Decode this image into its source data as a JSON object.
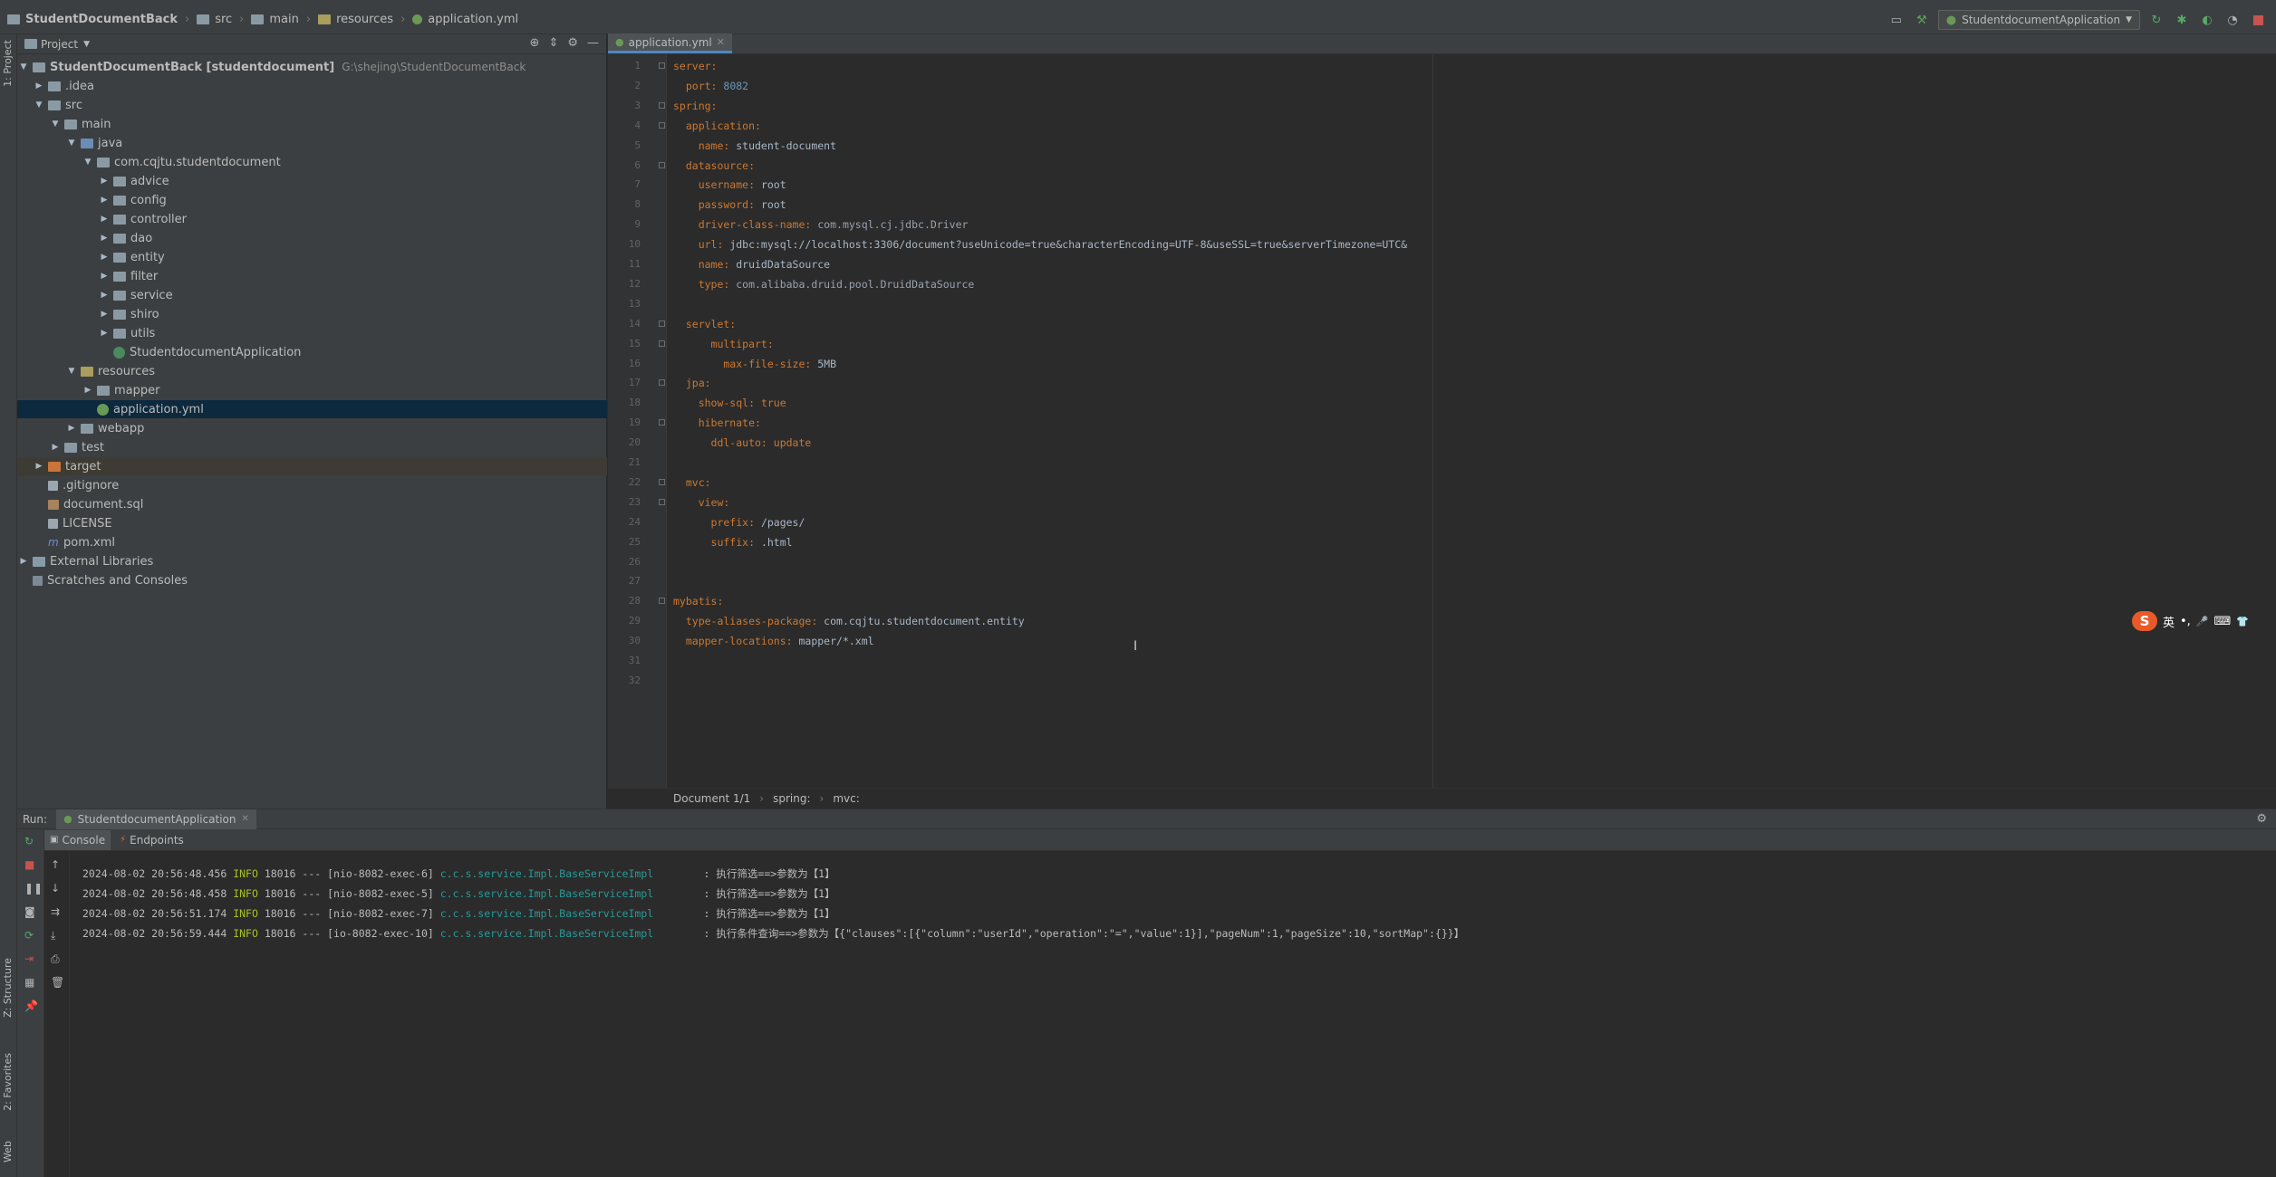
{
  "navbar": {
    "crumbs": [
      "StudentDocumentBack",
      "src",
      "main",
      "resources",
      "application.yml"
    ],
    "run_config": "StudentdocumentApplication"
  },
  "side_tabs": {
    "project": "1: Project",
    "structure": "Z: Structure",
    "favorites": "2: Favorites",
    "web": "Web"
  },
  "project_panel": {
    "title": "Project",
    "tree": [
      {
        "label": "StudentDocumentBack [studentdocument]",
        "path": "G:\\shejing\\StudentDocumentBack"
      },
      {
        "label": ".idea"
      },
      {
        "label": "src"
      },
      {
        "label": "main"
      },
      {
        "label": "java"
      },
      {
        "label": "com.cqjtu.studentdocument"
      },
      {
        "label": "advice"
      },
      {
        "label": "config"
      },
      {
        "label": "controller"
      },
      {
        "label": "dao"
      },
      {
        "label": "entity"
      },
      {
        "label": "filter"
      },
      {
        "label": "service"
      },
      {
        "label": "shiro"
      },
      {
        "label": "utils"
      },
      {
        "label": "StudentdocumentApplication"
      },
      {
        "label": "resources"
      },
      {
        "label": "mapper"
      },
      {
        "label": "application.yml"
      },
      {
        "label": "webapp"
      },
      {
        "label": "test"
      },
      {
        "label": "target"
      },
      {
        "label": ".gitignore"
      },
      {
        "label": "document.sql"
      },
      {
        "label": "LICENSE"
      },
      {
        "label": "pom.xml"
      },
      {
        "label": "External Libraries"
      },
      {
        "label": "Scratches and Consoles"
      }
    ]
  },
  "editor": {
    "tab": "application.yml",
    "lines": [
      {
        "n": "1",
        "key": "server:",
        "val": ""
      },
      {
        "n": "2",
        "key": "  port:",
        "val": " 8082"
      },
      {
        "n": "3",
        "key": "spring:",
        "val": ""
      },
      {
        "n": "4",
        "key": "  application:",
        "val": ""
      },
      {
        "n": "5",
        "key": "    name:",
        "val": " student-document"
      },
      {
        "n": "6",
        "key": "  datasource:",
        "val": ""
      },
      {
        "n": "7",
        "key": "    username:",
        "val": " root"
      },
      {
        "n": "8",
        "key": "    password:",
        "val": " root"
      },
      {
        "n": "9",
        "key": "    driver-class-name:",
        "val": " com.mysql.cj.jdbc.Driver"
      },
      {
        "n": "10",
        "key": "    url:",
        "val": " jdbc:mysql://localhost:3306/document?useUnicode=true&characterEncoding=UTF-8&useSSL=true&serverTimezone=UTC&"
      },
      {
        "n": "11",
        "key": "    name:",
        "val": " druidDataSource"
      },
      {
        "n": "12",
        "key": "    type:",
        "val": " com.alibaba.druid.pool.DruidDataSource"
      },
      {
        "n": "13",
        "key": "",
        "val": ""
      },
      {
        "n": "14",
        "key": "  servlet:",
        "val": ""
      },
      {
        "n": "15",
        "key": "      multipart:",
        "val": ""
      },
      {
        "n": "16",
        "key": "        max-file-size:",
        "val": " 5MB"
      },
      {
        "n": "17",
        "key": "  jpa:",
        "val": ""
      },
      {
        "n": "18",
        "key": "    show-sql:",
        "val": " true"
      },
      {
        "n": "19",
        "key": "    hibernate:",
        "val": ""
      },
      {
        "n": "20",
        "key": "      ddl-auto:",
        "val": " update"
      },
      {
        "n": "21",
        "key": "",
        "val": ""
      },
      {
        "n": "22",
        "key": "  mvc:",
        "val": ""
      },
      {
        "n": "23",
        "key": "    view:",
        "val": ""
      },
      {
        "n": "24",
        "key": "      prefix:",
        "val": " /pages/"
      },
      {
        "n": "25",
        "key": "      suffix:",
        "val": " .html"
      },
      {
        "n": "26",
        "key": "",
        "val": ""
      },
      {
        "n": "27",
        "key": "",
        "val": ""
      },
      {
        "n": "28",
        "key": "mybatis:",
        "val": ""
      },
      {
        "n": "29",
        "key": "  type-aliases-package:",
        "val": " com.cqjtu.studentdocument.entity"
      },
      {
        "n": "30",
        "key": "  mapper-locations:",
        "val": " mapper/*.xml"
      },
      {
        "n": "31",
        "key": "",
        "val": ""
      },
      {
        "n": "32",
        "key": "",
        "val": ""
      }
    ],
    "breadcrumb": [
      "Document 1/1",
      "spring:",
      "mvc:"
    ]
  },
  "ime": {
    "logo": "S",
    "lang": "英",
    "punct": "•,",
    "mic": "🎤",
    "kbd": "⌨",
    "skin": "👕"
  },
  "run_panel": {
    "label": "Run:",
    "app_tab": "StudentdocumentApplication",
    "tabs": [
      "Console",
      "Endpoints"
    ],
    "log": [
      {
        "ts": "2024-08-02 20:56:48.456",
        "level": "INFO",
        "pid": "18016",
        "sep": "---",
        "thread": "[nio-8082-exec-6]",
        "cls": "c.c.s.service.Impl.BaseServiceImpl",
        "msg": ": 执行筛选==>参数为【1】"
      },
      {
        "ts": "2024-08-02 20:56:48.458",
        "level": "INFO",
        "pid": "18016",
        "sep": "---",
        "thread": "[nio-8082-exec-5]",
        "cls": "c.c.s.service.Impl.BaseServiceImpl",
        "msg": ": 执行筛选==>参数为【1】"
      },
      {
        "ts": "2024-08-02 20:56:51.174",
        "level": "INFO",
        "pid": "18016",
        "sep": "---",
        "thread": "[nio-8082-exec-7]",
        "cls": "c.c.s.service.Impl.BaseServiceImpl",
        "msg": ": 执行筛选==>参数为【1】"
      },
      {
        "ts": "2024-08-02 20:56:59.444",
        "level": "INFO",
        "pid": "18016",
        "sep": "---",
        "thread": "[io-8082-exec-10]",
        "cls": "c.c.s.service.Impl.BaseServiceImpl",
        "msg": ": 执行条件查询==>参数为【{\"clauses\":[{\"column\":\"userId\",\"operation\":\"=\",\"value\":1}],\"pageNum\":1,\"pageSize\":10,\"sortMap\":{}}】"
      }
    ]
  }
}
